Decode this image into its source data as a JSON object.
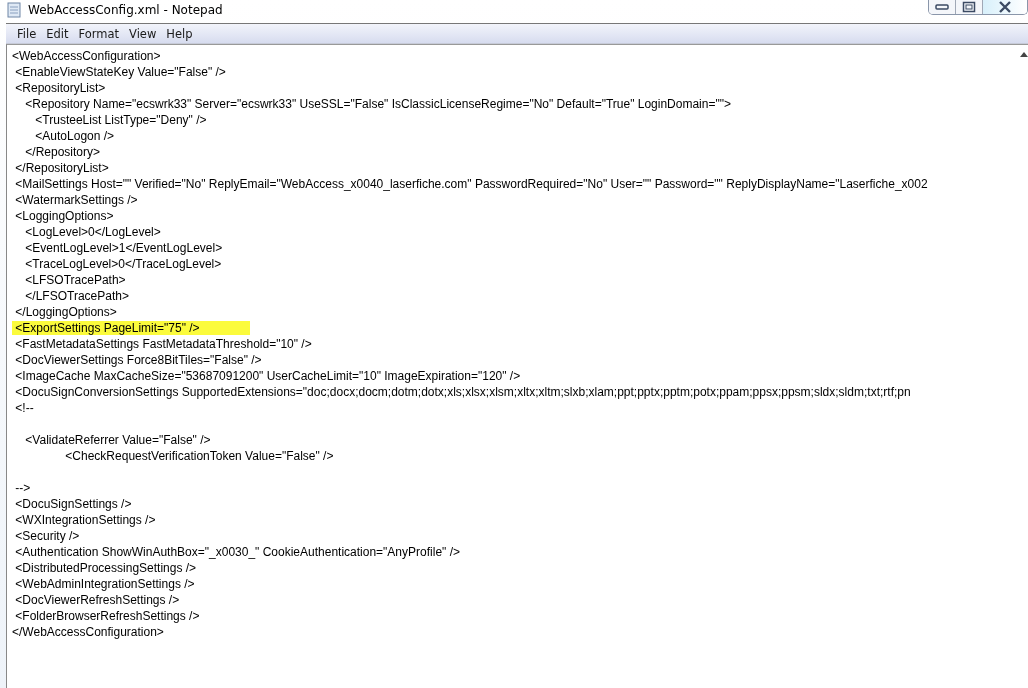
{
  "window": {
    "title": "WebAccessConfig.xml - Notepad"
  },
  "menu": [
    {
      "label": "File"
    },
    {
      "label": "Edit"
    },
    {
      "label": "Format"
    },
    {
      "label": "View"
    },
    {
      "label": "Help"
    }
  ],
  "lines": [
    {
      "kind": "text",
      "text": "<WebAccessConfiguration>",
      "highlighted": false
    },
    {
      "kind": "text",
      "text": " <EnableViewStateKey Value=\"False\" />",
      "highlighted": false
    },
    {
      "kind": "text",
      "text": " <RepositoryList>",
      "highlighted": false
    },
    {
      "kind": "text",
      "text": "    <Repository Name=\"ecswrk33\" Server=\"ecswrk33\" UseSSL=\"False\" IsClassicLicenseRegime=\"No\" Default=\"True\" LoginDomain=\"\">",
      "highlighted": false
    },
    {
      "kind": "text",
      "text": "       <TrusteeList ListType=\"Deny\" />",
      "highlighted": false
    },
    {
      "kind": "text",
      "text": "       <AutoLogon />",
      "highlighted": false
    },
    {
      "kind": "text",
      "text": "    </Repository>",
      "highlighted": false
    },
    {
      "kind": "text",
      "text": " </RepositoryList>",
      "highlighted": false
    },
    {
      "kind": "text",
      "text": " <MailSettings Host=\"\" Verified=\"No\" ReplyEmail=\"WebAccess_x0040_laserfiche.com\" PasswordRequired=\"No\" User=\"\" Password=\"\" ReplyDisplayName=\"Laserfiche_x002",
      "highlighted": false
    },
    {
      "kind": "text",
      "text": " <WatermarkSettings />",
      "highlighted": false
    },
    {
      "kind": "text",
      "text": " <LoggingOptions>",
      "highlighted": false
    },
    {
      "kind": "text",
      "text": "    <LogLevel>0</LogLevel>",
      "highlighted": false
    },
    {
      "kind": "text",
      "text": "    <EventLogLevel>1</EventLogLevel>",
      "highlighted": false
    },
    {
      "kind": "text",
      "text": "    <TraceLogLevel>0</TraceLogLevel>",
      "highlighted": false
    },
    {
      "kind": "text",
      "text": "    <LFSOTracePath>",
      "highlighted": false
    },
    {
      "kind": "text",
      "text": "    </LFSOTracePath>",
      "highlighted": false
    },
    {
      "kind": "text",
      "text": " </LoggingOptions>",
      "highlighted": false
    },
    {
      "kind": "text",
      "text": " <ExportSettings PageLimit=\"75\" />",
      "highlighted": true
    },
    {
      "kind": "text",
      "text": " <FastMetadataSettings FastMetadataThreshold=\"10\" />",
      "highlighted": false
    },
    {
      "kind": "text",
      "text": " <DocViewerSettings Force8BitTiles=\"False\" />",
      "highlighted": false
    },
    {
      "kind": "text",
      "text": " <ImageCache MaxCacheSize=\"53687091200\" UserCacheLimit=\"10\" ImageExpiration=\"120\" />",
      "highlighted": false
    },
    {
      "kind": "text",
      "text": " <DocuSignConversionSettings SupportedExtensions=\"doc;docx;docm;dotm;dotx;xls;xlsx;xlsm;xltx;xltm;slxb;xlam;ppt;pptx;pptm;potx;ppam;ppsx;ppsm;sldx;sldm;txt;rtf;pn",
      "highlighted": false
    },
    {
      "kind": "text",
      "text": " <!--",
      "highlighted": false
    },
    {
      "kind": "blank"
    },
    {
      "kind": "text",
      "text": "    <ValidateReferrer Value=\"False\" />",
      "highlighted": false
    },
    {
      "kind": "text",
      "text": "                <CheckRequestVerificationToken Value=\"False\" />",
      "highlighted": false
    },
    {
      "kind": "blank"
    },
    {
      "kind": "text",
      "text": " -->",
      "highlighted": false
    },
    {
      "kind": "text",
      "text": " <DocuSignSettings />",
      "highlighted": false
    },
    {
      "kind": "text",
      "text": " <WXIntegrationSettings />",
      "highlighted": false
    },
    {
      "kind": "text",
      "text": " <Security />",
      "highlighted": false
    },
    {
      "kind": "text",
      "text": " <Authentication ShowWinAuthBox=\"_x0030_\" CookieAuthentication=\"AnyProfile\" />",
      "highlighted": false
    },
    {
      "kind": "text",
      "text": " <DistributedProcessingSettings />",
      "highlighted": false
    },
    {
      "kind": "text",
      "text": " <WebAdminIntegrationSettings />",
      "highlighted": false
    },
    {
      "kind": "text",
      "text": " <DocViewerRefreshSettings />",
      "highlighted": false
    },
    {
      "kind": "text",
      "text": " <FolderBrowserRefreshSettings />",
      "highlighted": false
    },
    {
      "kind": "text",
      "text": "</WebAccessConfiguration>",
      "highlighted": false
    }
  ]
}
